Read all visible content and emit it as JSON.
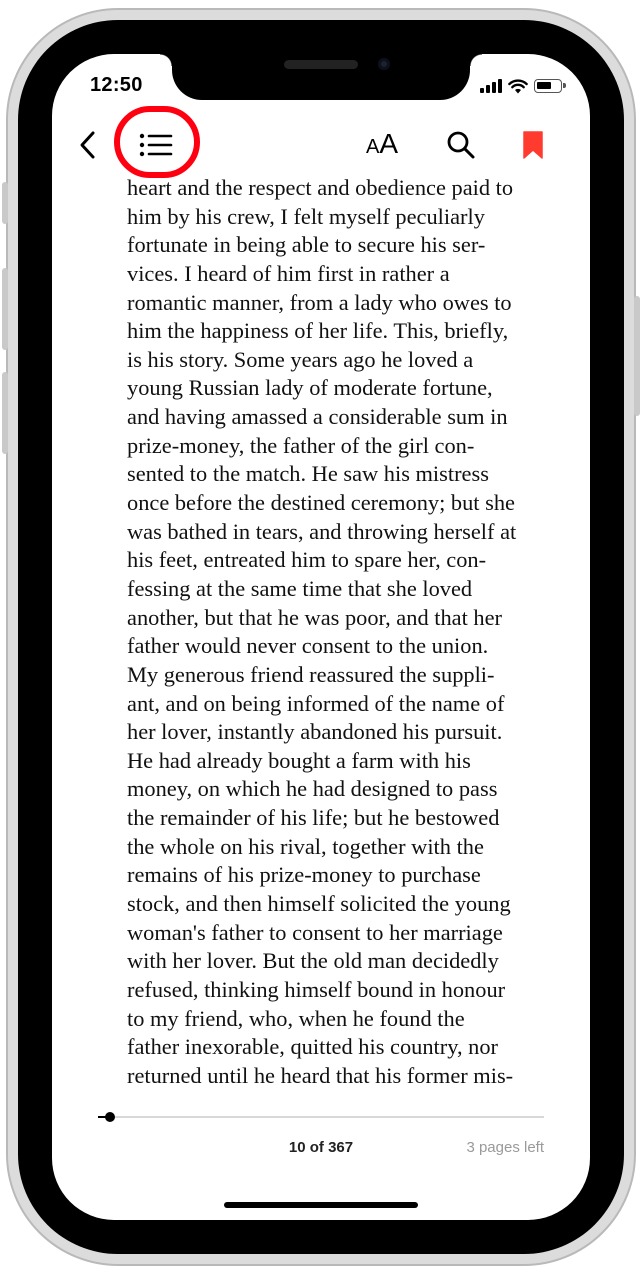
{
  "status_bar": {
    "time": "12:50"
  },
  "toolbar": {
    "back_icon": "chevron-left-icon",
    "contents_icon": "list-icon",
    "font_label_small": "A",
    "font_label_large": "A",
    "search_icon": "search-icon",
    "bookmark_icon": "bookmark-icon",
    "bookmark_color": "#ff3b30",
    "highlight_color": "#ff0010"
  },
  "book": {
    "lines": [
      "heart and the respect and obedience paid to",
      "him by his crew, I felt myself peculiarly",
      "fortunate in being able to secure his ser-",
      "vices. I heard of him first in rather a",
      "romantic manner, from a lady who owes to",
      "him the happiness of her life. This, briefly,",
      "is his story. Some years ago he loved a",
      "young Russian lady of moderate fortune,",
      "and having amassed a considerable sum in",
      "prize-money, the father of the girl con-",
      "sented to the match. He saw his mistress",
      "once before the destined ceremony; but she",
      "was bathed in tears, and throwing herself at",
      "his feet, entreated him to spare her, con-",
      "fessing at the same time that she loved",
      "another, but that he was poor, and that her",
      "father would never consent to the union.",
      "My generous friend reassured the suppli-",
      "ant, and on being informed of the name of",
      "her lover, instantly abandoned his pursuit.",
      "He had already bought a farm with his",
      "money, on which he had designed to pass",
      "the remainder of his life; but he bestowed",
      "the whole on his rival, together with the",
      "remains of his prize-money to purchase",
      "stock, and then himself solicited the young",
      "woman's father to consent to her marriage",
      "with her lover. But the old man decidedly",
      "refused, thinking himself bound in honour",
      "to my friend, who, when he found the",
      "father inexorable, quitted his country, nor",
      "returned until he heard that his former mis-"
    ]
  },
  "footer": {
    "progress_fraction": 0.027,
    "page_label": "10 of 367",
    "pages_left": "3 pages left"
  }
}
